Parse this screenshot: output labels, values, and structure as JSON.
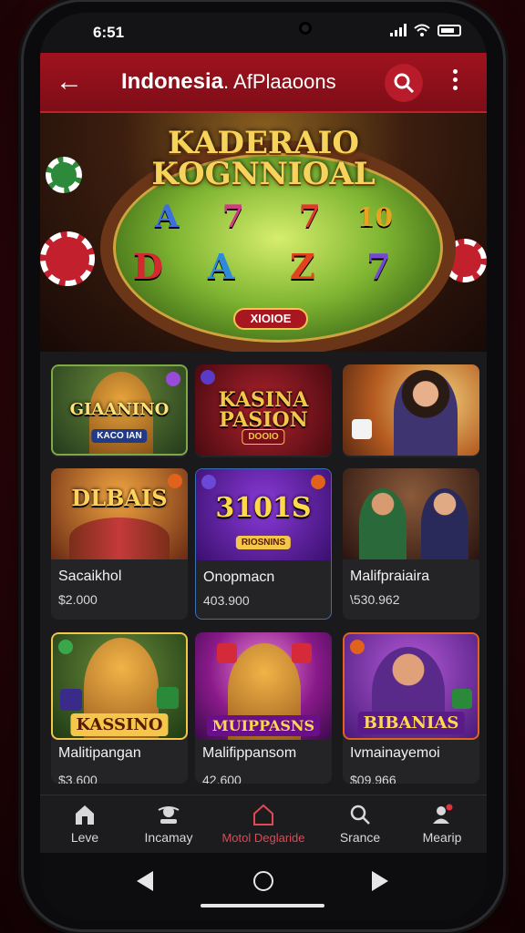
{
  "status": {
    "time": "6:51"
  },
  "appbar": {
    "title": "Indonesia",
    "subtitle": ". AfPlaaoons"
  },
  "hero": {
    "title_line1": "KADERAIO",
    "title_line2": "KOGNNIOAL",
    "reels_top": [
      "A",
      "7",
      "7",
      "10"
    ],
    "reels_bottom": [
      "D",
      "A",
      "Z",
      "7"
    ],
    "badge": "XIOIOE"
  },
  "cards": [
    {
      "logo": "GIAANINO",
      "tag": "KACO IAN",
      "name": "",
      "price": ""
    },
    {
      "logo": "KASINA\nPASION",
      "tag": "DOOIO",
      "name": "",
      "price": ""
    },
    {
      "logo": "",
      "tag": "",
      "name": "",
      "price": ""
    },
    {
      "logo": "DLBAIS",
      "tag": "",
      "name": "Sacaikhol",
      "price": "$2.000"
    },
    {
      "logo": "3101S",
      "tag": "RIOSNINS",
      "name": "Onopmacn",
      "price": "403.900"
    },
    {
      "logo": "",
      "tag": "",
      "name": "Malifpraiaira",
      "price": "\\530.962"
    },
    {
      "logo": "KASSINO",
      "tag": "",
      "name": "Malitipangan",
      "price": "$3.600"
    },
    {
      "logo": "MUIPPASNS",
      "tag": "",
      "name": "Malifippansom",
      "price": "42.600"
    },
    {
      "logo": "BIBANIAS",
      "tag": "",
      "name": "Ivmainayemoi",
      "price": "$09.966"
    }
  ],
  "bottomnav": [
    {
      "label": "Leve",
      "icon": "home-icon"
    },
    {
      "label": "Incamay",
      "icon": "dealer-icon"
    },
    {
      "label": "Motol Deglaride",
      "icon": "house-outline-icon"
    },
    {
      "label": "Srance",
      "icon": "search-icon"
    },
    {
      "label": "Mearip",
      "icon": "profile-icon"
    }
  ],
  "colors": {
    "appbar": "#8f111c",
    "active": "#e04854",
    "background": "#141416"
  }
}
